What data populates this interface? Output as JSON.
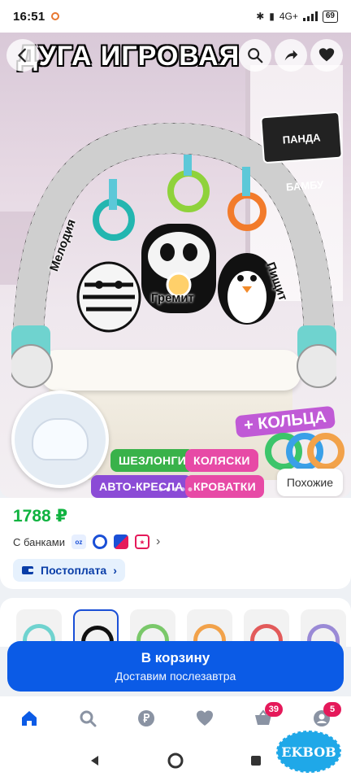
{
  "status_bar": {
    "time": "16:51",
    "network": "4G+",
    "battery": "69"
  },
  "hero": {
    "title": "ДУГА ИГРОВАЯ",
    "brand_badge": "ПАНДА БАМБУ",
    "toy_labels": [
      "Мелодия",
      "Гремит",
      "Пищит"
    ],
    "tags": [
      "ШЕЗЛОНГИ",
      "КОЛЯСКИ",
      "АВТО-КРЕСЛА",
      "КРОВАТКИ"
    ],
    "rings_label": "+ КОЛЬЦА",
    "similar_button": "Похожие"
  },
  "product": {
    "price": "1788 ₽",
    "banks_label": "С банками",
    "postpay_label": "Постоплата"
  },
  "cart": {
    "button_label": "В корзину",
    "delivery_label": "Доставим послезавтра"
  },
  "tabbar": {
    "cart_count": "39",
    "profile_count": "5"
  },
  "watermark": "EKBOB",
  "colors": {
    "accent": "#0b5be6",
    "price": "#10b340",
    "badge": "#e5195a"
  }
}
